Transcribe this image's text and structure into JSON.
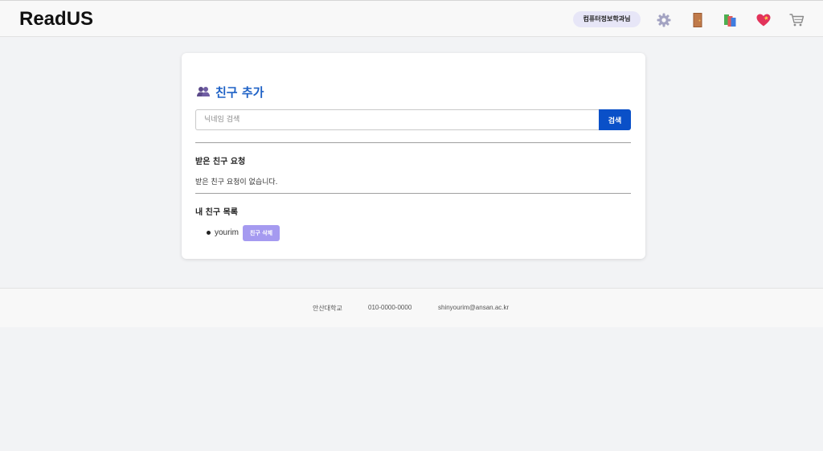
{
  "header": {
    "logo": "ReadUS",
    "user_badge": "컴퓨터정보학과님",
    "icons": [
      "gear-icon",
      "door-icon",
      "books-icon",
      "heart-icon",
      "cart-icon"
    ]
  },
  "friend_page": {
    "title": "친구 추가",
    "title_icon": "people-icon",
    "search": {
      "placeholder": "닉네임 검색",
      "value": "",
      "button_label": "검색"
    },
    "received_requests": {
      "heading": "받은 친구 요청",
      "empty_message": "받은 친구 요청이 없습니다."
    },
    "my_friends": {
      "heading": "내 친구 목록",
      "items": [
        {
          "name": "yourim",
          "delete_label": "친구 삭제"
        }
      ]
    }
  },
  "footer": {
    "school": "안산대학교",
    "phone": "010-0000-0000",
    "email": "shinyourim@ansan.ac.kr"
  },
  "colors": {
    "accent_blue": "#0a50c8",
    "title_blue": "#1f62c6",
    "delete_purple": "#a59af0",
    "badge_bg": "#e7e6f7"
  }
}
